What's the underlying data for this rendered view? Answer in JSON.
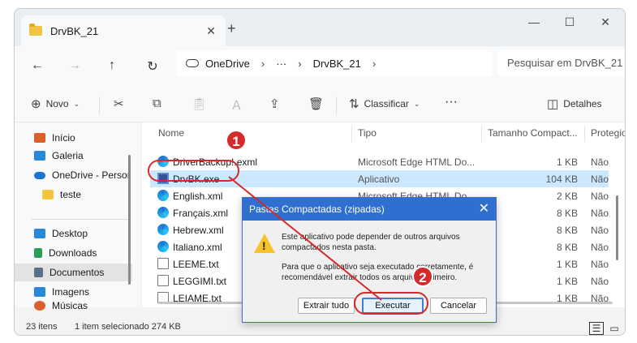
{
  "tab": {
    "title": "DrvBK_21",
    "close": "✕",
    "new": "+"
  },
  "window_controls": {
    "minimize": "—",
    "maximize": "☐",
    "close": "✕"
  },
  "nav": {
    "back": "←",
    "forward": "→",
    "up": "↑",
    "refresh": "↻",
    "breadcrumb": [
      "OneDrive",
      "DrvBK_21"
    ],
    "more": "···",
    "search_placeholder": "Pesquisar em DrvBK_21"
  },
  "commands": {
    "new": "Novo",
    "sort": "Classificar",
    "more": "···",
    "details": "Detalhes"
  },
  "sidebar": {
    "items": [
      {
        "label": "Início",
        "color": "#d9622b"
      },
      {
        "label": "Galeria",
        "color": "#2b88d8"
      },
      {
        "label": "OneDrive - Persor",
        "color": "#1e73d1"
      },
      {
        "label": "teste",
        "color": "#f2c443"
      },
      {
        "label": "Desktop",
        "color": "#2b88d8"
      },
      {
        "label": "Downloads",
        "color": "#2f9b5a"
      },
      {
        "label": "Documentos",
        "color": "#5c6f8a"
      },
      {
        "label": "Imagens",
        "color": "#2b88d8"
      },
      {
        "label": "Músicas",
        "color": "#d9622b"
      }
    ]
  },
  "columns": {
    "name": "Nome",
    "type": "Tipo",
    "size": "Tamanho Compact...",
    "protected": "Protegio"
  },
  "files": [
    {
      "name": "DriverBackup!.exml",
      "type": "Microsoft Edge HTML Do...",
      "size": "1 KB",
      "protected": "Não",
      "icon": "edge"
    },
    {
      "name": "DrvBK.exe",
      "type": "Aplicativo",
      "size": "104 KB",
      "protected": "Não",
      "icon": "exe"
    },
    {
      "name": "English.xml",
      "type": "Microsoft Edge HTML Do...",
      "size": "2 KB",
      "protected": "Não",
      "icon": "edge"
    },
    {
      "name": "Français.xml",
      "type": "",
      "size": "8 KB",
      "protected": "Não",
      "icon": "edge"
    },
    {
      "name": "Hebrew.xml",
      "type": "",
      "size": "8 KB",
      "protected": "Não",
      "icon": "edge"
    },
    {
      "name": "Italiano.xml",
      "type": "",
      "size": "8 KB",
      "protected": "Não",
      "icon": "edge"
    },
    {
      "name": "LEEME.txt",
      "type": "",
      "size": "1 KB",
      "protected": "Não",
      "icon": "txt"
    },
    {
      "name": "LEGGIMI.txt",
      "type": "",
      "size": "1 KB",
      "protected": "Não",
      "icon": "txt"
    },
    {
      "name": "LEIAME.txt",
      "type": "",
      "size": "1 KB",
      "protected": "Não",
      "icon": "txt"
    }
  ],
  "status": {
    "count": "23 itens",
    "selection": "1 item selecionado  274 KB"
  },
  "dialog": {
    "title": "Pastas Compactadas (zipadas)",
    "close": "✕",
    "message1": "Este aplicativo pode depender de outros arquivos compactados nesta pasta.",
    "message2": "Para que o aplicativo seja executado corretamente, é recomendável extrair todos os arquivos primeiro.",
    "buttons": {
      "extract": "Extrair tudo",
      "run": "Executar",
      "cancel": "Cancelar"
    }
  },
  "annotations": {
    "step1": "1",
    "step2": "2",
    "color": "#d42a2a"
  }
}
